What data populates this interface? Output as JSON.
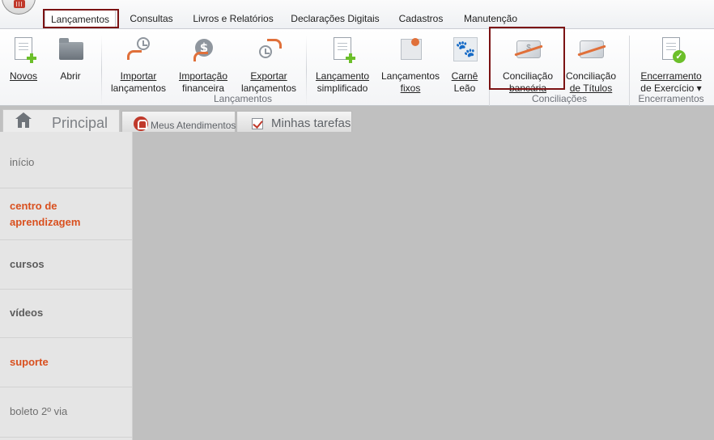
{
  "menubar": {
    "tabs": [
      {
        "label": "Lançamentos"
      },
      {
        "label": "Consultas"
      },
      {
        "label": "Livros e Relatórios"
      },
      {
        "label": "Declarações Digitais"
      },
      {
        "label": "Cadastros"
      },
      {
        "label": "Manutenção"
      }
    ]
  },
  "ribbon": {
    "buttons": {
      "novos": {
        "label": "Novos",
        "icon": "new-document-icon"
      },
      "abrir": {
        "label": "Abrir",
        "icon": "folder-icon"
      },
      "importar": {
        "line1": "Importar",
        "line2": "lançamentos",
        "icon": "import-icon"
      },
      "importacao": {
        "line1": "Importação",
        "line2": "financeira",
        "icon": "money-import-icon"
      },
      "exportar": {
        "line1": "Exportar",
        "line2": "lançamentos",
        "icon": "export-icon"
      },
      "simplificado": {
        "line1": "Lançamento",
        "line2": "simplificado",
        "icon": "new-entry-icon"
      },
      "fixos": {
        "line1": "Lançamentos",
        "line2": "fixos",
        "icon": "pin-icon"
      },
      "carne": {
        "line1": "Carnê",
        "line2": "Leão",
        "icon": "paw-icon"
      },
      "conciliacao_bancaria": {
        "line1": "Conciliação",
        "line2": "bancária",
        "icon": "bank-reconciliation-icon"
      },
      "conciliacao_titulos": {
        "line1": "Conciliação",
        "line2": "de Títulos",
        "icon": "title-reconciliation-icon"
      },
      "encerramento": {
        "line1": "Encerramento",
        "line2": "de Exercício ▾",
        "icon": "closing-icon"
      }
    },
    "groups": {
      "lancamentos": "Lançamentos",
      "conciliacoes": "Conciliações",
      "encerramentos": "Encerramentos"
    }
  },
  "tabs2": {
    "principal": "Principal",
    "atendimentos": "Meus Atendimentos",
    "tarefas": "Minhas tarefas"
  },
  "sidebar": {
    "items": [
      {
        "label": "início"
      },
      {
        "line1": "centro de",
        "line2": "aprendizagem"
      },
      {
        "label": "cursos"
      },
      {
        "label": "vídeos"
      },
      {
        "label": "suporte"
      },
      {
        "label": "boleto 2º via"
      }
    ]
  },
  "colors": {
    "highlight": "#7b1213",
    "accent_orange": "#d9501f",
    "workspace": "#c0c0c0"
  }
}
